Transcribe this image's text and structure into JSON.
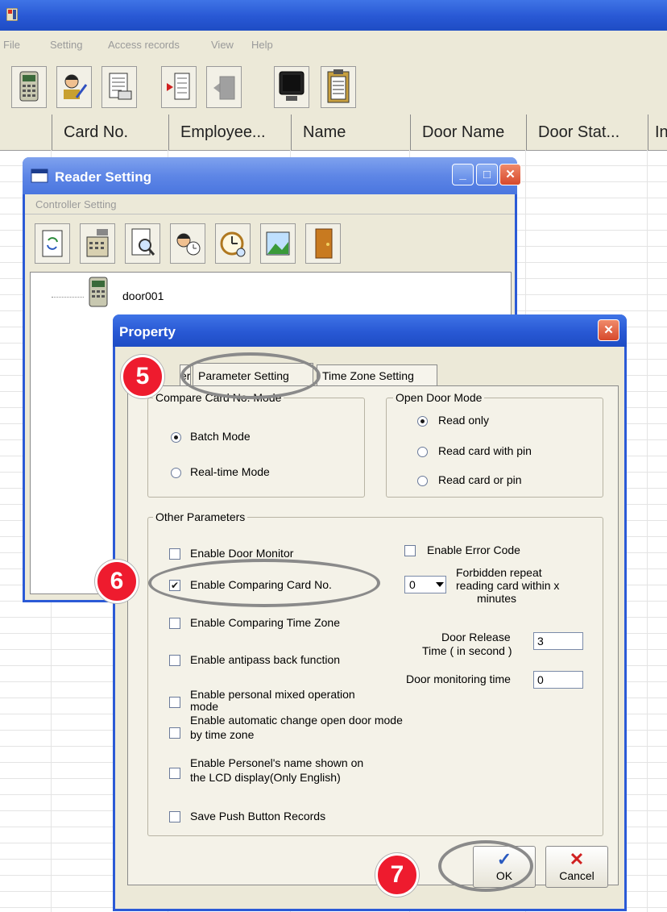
{
  "menubar": [
    "File",
    "Setting",
    "Access records",
    "View",
    "Help"
  ],
  "toolbar_icons": [
    "controller-icon",
    "user-edit-icon",
    "document-icon",
    "import-icon",
    "export-icon",
    "monitor-icon",
    "clipboard-icon"
  ],
  "grid": {
    "columns": [
      "",
      "Card No.",
      "Employee...",
      "Name",
      "Door Name",
      "Door Stat...",
      "In"
    ]
  },
  "reader_window": {
    "title": "Reader Setting",
    "menu": "Controller Setting",
    "toolbar_icons": [
      "refresh-icon",
      "controller-settings-icon",
      "search-icon",
      "user-clock-icon",
      "alarm-icon",
      "picture-icon",
      "door-icon"
    ],
    "tree_item": "door001"
  },
  "property_dialog": {
    "title": "Property",
    "tabs": [
      "eral",
      "Parameter Setting",
      "Time Zone Setting"
    ],
    "compare_group": {
      "label": "Compare Card No. Mode",
      "options": [
        "Batch Mode",
        "Real-time Mode"
      ],
      "selected": "Batch Mode"
    },
    "open_door_group": {
      "label": "Open Door Mode",
      "options": [
        "Read only",
        "Read card with pin",
        "Read card or pin"
      ],
      "selected": "Read only"
    },
    "other": {
      "label": "Other Parameters",
      "enable_door_monitor": "Enable Door Monitor",
      "enable_comparing_card": "Enable Comparing Card No.",
      "enable_comparing_time_zone": "Enable Comparing Time Zone",
      "enable_antipass": "Enable antipass back function",
      "personal_mixed_line1": "Enable personal mixed operation",
      "personal_mixed_line2": "mode",
      "auto_change_line1": "Enable automatic change open door mode",
      "auto_change_line2": "by time zone",
      "personel_name_line1": "Enable Personel's  name shown on",
      "personel_name_line2": "the LCD display(Only English)",
      "save_push_button": "Save Push Button Records",
      "enable_error_code": "Enable Error Code",
      "forbidden_select_value": "0",
      "forbidden_line1": "Forbidden repeat",
      "forbidden_line2": "reading card within x",
      "forbidden_line3": "minutes",
      "door_release_line1": "Door Release",
      "door_release_line2": "Time ( in second )",
      "door_release_value": "3",
      "door_monitoring_label": "Door monitoring time",
      "door_monitoring_value": "0"
    },
    "ok_label": "OK",
    "cancel_label": "Cancel"
  },
  "annotations": {
    "step5": "5",
    "step6": "6",
    "step7": "7",
    "accent": "#ee1b2e"
  }
}
